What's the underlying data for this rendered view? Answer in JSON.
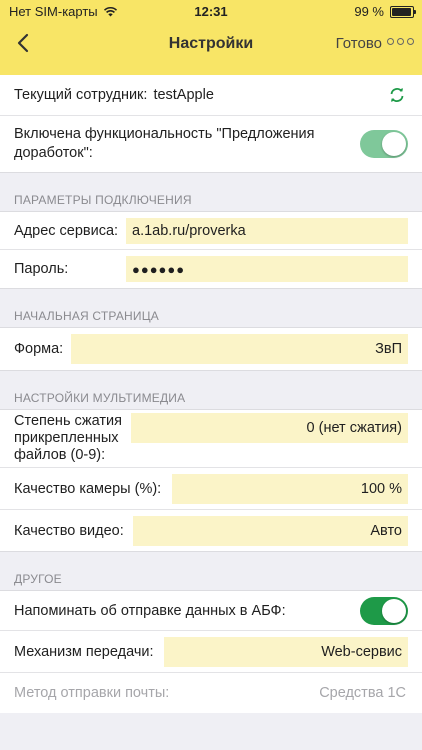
{
  "status": {
    "carrier": "Нет SIM-карты",
    "time": "12:31",
    "battery": "99 %"
  },
  "nav": {
    "title": "Настройки",
    "done_label": "Готово"
  },
  "employee": {
    "label": "Текущий сотрудник:",
    "value": "testApple"
  },
  "improvements": {
    "label_line1": "Включена функциональность \"Предложения",
    "label_line2": "доработок\":",
    "enabled": true
  },
  "connection": {
    "header": "ПАРАМЕТРЫ ПОДКЛЮЧЕНИЯ",
    "service_label": "Адрес сервиса:",
    "service_value": "a.1ab.ru/proverka",
    "password_label": "Пароль:",
    "password_value": "●●●●●●"
  },
  "start_page": {
    "header": "НАЧАЛЬНАЯ СТРАНИЦА",
    "form_label": "Форма:",
    "form_value": "ЗвП"
  },
  "multimedia": {
    "header": "НАСТРОЙКИ МУЛЬТИМЕДИА",
    "compress_line1": "Степень сжатия",
    "compress_line2": "прикрепленных",
    "compress_line3": "файлов (0-9):",
    "compress_value": "0 (нет сжатия)",
    "camera_label": "Качество камеры (%):",
    "camera_value": "100 %",
    "video_label": "Качество видео:",
    "video_value": "Авто"
  },
  "other": {
    "header": "ДРУГОЕ",
    "remind_label": "Напоминать об отправке данных в АБФ:",
    "remind_enabled": true,
    "transfer_label": "Механизм передачи:",
    "transfer_value": "Web-сервис",
    "mail_label": "Метод отправки почты:",
    "mail_value": "Средства 1С"
  },
  "colors": {
    "topbar": "#f8e566",
    "field": "#fbf4c8",
    "switch_light": "#7fc89a",
    "switch_dark": "#1e9a48",
    "accent": "#1e9a48"
  }
}
